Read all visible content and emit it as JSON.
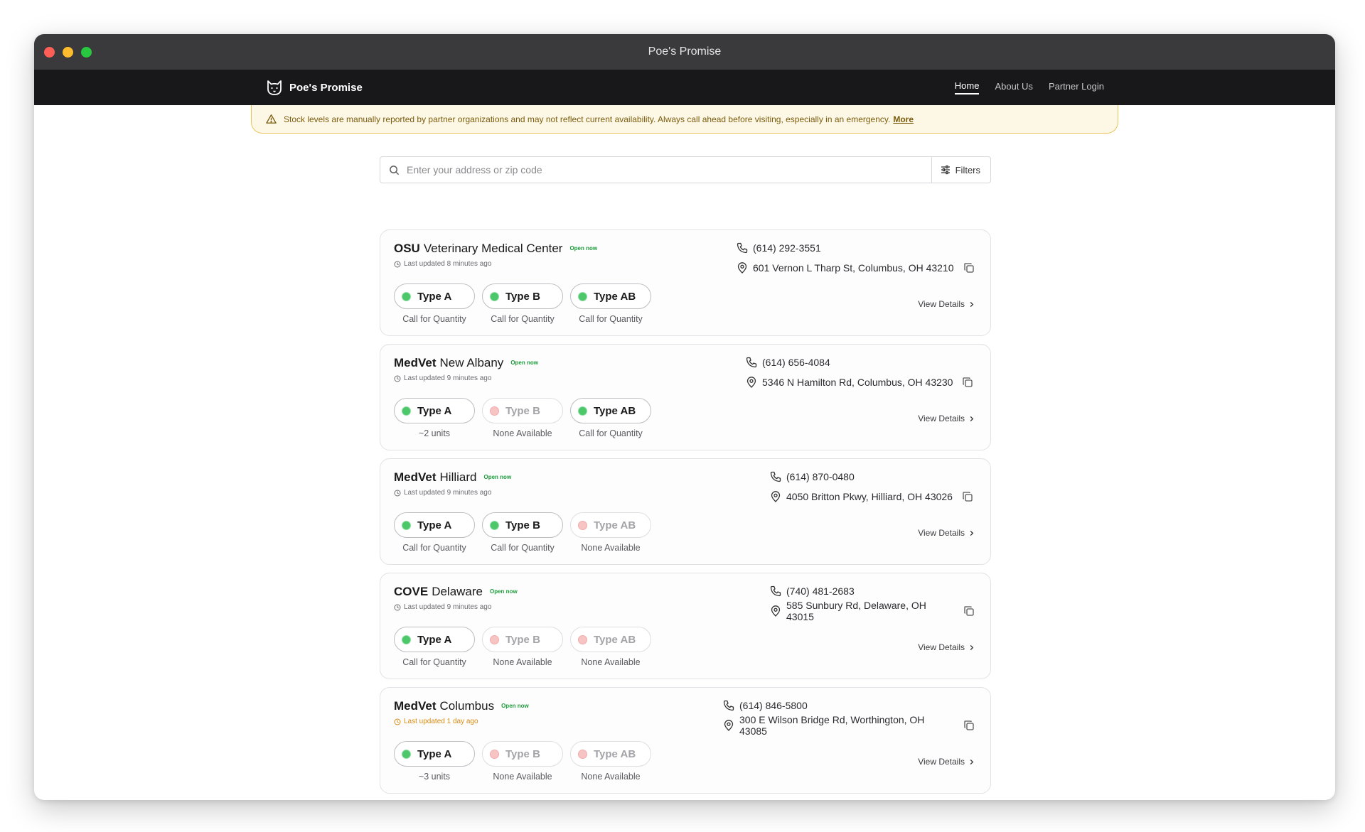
{
  "window": {
    "title": "Poe's Promise"
  },
  "nav": {
    "brand": "Poe's Promise",
    "links": [
      {
        "label": "Home",
        "active": true
      },
      {
        "label": "About Us",
        "active": false
      },
      {
        "label": "Partner Login",
        "active": false
      }
    ]
  },
  "alert": {
    "text": "Stock levels are manually reported by partner organizations and may not reflect current availability. Always call ahead before visiting, especially in an emergency.",
    "more": "More"
  },
  "search": {
    "placeholder": "Enter your address or zip code",
    "value": "",
    "filters_label": "Filters"
  },
  "colors": {
    "available": "#4cc86a",
    "unavailable": "#f7c4c4",
    "open": "#1e9b3c",
    "alert_border": "#e9c45a",
    "stale": "#d98a0e"
  },
  "view_details_label": "View Details",
  "clinics": [
    {
      "abbr": "OSU",
      "name": "Veterinary Medical Center",
      "status": "Open now",
      "updated": "Last updated 8 minutes ago",
      "stale": false,
      "phone": "(614) 292-3551",
      "address": "601 Vernon L Tharp St, Columbus, OH 43210",
      "types": [
        {
          "label": "Type A",
          "available": true,
          "qty": "Call for Quantity"
        },
        {
          "label": "Type B",
          "available": true,
          "qty": "Call for Quantity"
        },
        {
          "label": "Type AB",
          "available": true,
          "qty": "Call for Quantity"
        }
      ]
    },
    {
      "abbr": "MedVet",
      "name": "New Albany",
      "status": "Open now",
      "updated": "Last updated 9 minutes ago",
      "stale": false,
      "phone": "(614) 656-4084",
      "address": "5346 N Hamilton Rd, Columbus, OH 43230",
      "types": [
        {
          "label": "Type A",
          "available": true,
          "qty": "~2 units"
        },
        {
          "label": "Type B",
          "available": false,
          "qty": "None Available"
        },
        {
          "label": "Type AB",
          "available": true,
          "qty": "Call for Quantity"
        }
      ]
    },
    {
      "abbr": "MedVet",
      "name": "Hilliard",
      "status": "Open now",
      "updated": "Last updated 9 minutes ago",
      "stale": false,
      "phone": "(614) 870-0480",
      "address": "4050 Britton Pkwy, Hilliard, OH 43026",
      "types": [
        {
          "label": "Type A",
          "available": true,
          "qty": "Call for Quantity"
        },
        {
          "label": "Type B",
          "available": true,
          "qty": "Call for Quantity"
        },
        {
          "label": "Type AB",
          "available": false,
          "qty": "None Available"
        }
      ]
    },
    {
      "abbr": "COVE",
      "name": "Delaware",
      "status": "Open now",
      "updated": "Last updated 9 minutes ago",
      "stale": false,
      "phone": "(740) 481-2683",
      "address": "585 Sunbury Rd, Delaware, OH 43015",
      "types": [
        {
          "label": "Type A",
          "available": true,
          "qty": "Call for Quantity"
        },
        {
          "label": "Type B",
          "available": false,
          "qty": "None Available"
        },
        {
          "label": "Type AB",
          "available": false,
          "qty": "None Available"
        }
      ]
    },
    {
      "abbr": "MedVet",
      "name": "Columbus",
      "status": "Open now",
      "updated": "Last updated 1 day ago",
      "stale": true,
      "phone": "(614) 846-5800",
      "address": "300 E Wilson Bridge Rd, Worthington, OH 43085",
      "types": [
        {
          "label": "Type A",
          "available": true,
          "qty": "~3 units"
        },
        {
          "label": "Type B",
          "available": false,
          "qty": "None Available"
        },
        {
          "label": "Type AB",
          "available": false,
          "qty": "None Available"
        }
      ]
    }
  ]
}
